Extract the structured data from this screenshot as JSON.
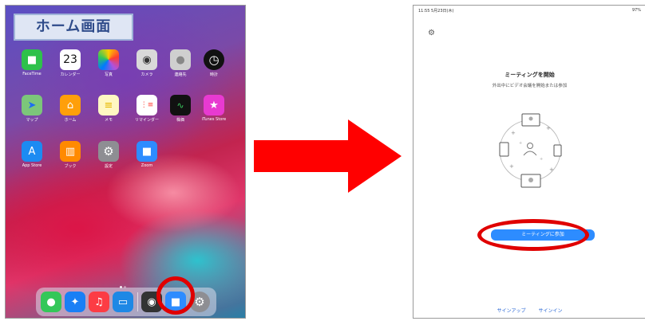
{
  "left_screen": {
    "label": "ホーム画面",
    "rows": [
      [
        {
          "name": "FaceTime",
          "icon": "facetime-icon",
          "color": "#2ec14b"
        },
        {
          "name": "カレンダー",
          "icon": "calendar-icon",
          "color": "#ffffff",
          "day": "23"
        },
        {
          "name": "写真",
          "icon": "photos-icon",
          "color": "#ffffff"
        },
        {
          "name": "カメラ",
          "icon": "camera-icon",
          "color": "#d9d9d9"
        },
        {
          "name": "連絡先",
          "icon": "contacts-icon",
          "color": "#cfcfcf"
        },
        {
          "name": "時計",
          "icon": "clock-icon",
          "color": "#111111"
        }
      ],
      [
        {
          "name": "マップ",
          "icon": "maps-icon",
          "color": "#7cc67a"
        },
        {
          "name": "ホーム",
          "icon": "home-icon",
          "color": "#ff9f0a"
        },
        {
          "name": "メモ",
          "icon": "notes-icon",
          "color": "#fff7c2"
        },
        {
          "name": "リマインダー",
          "icon": "reminders-icon",
          "color": "#ffffff"
        },
        {
          "name": "株価",
          "icon": "stocks-icon",
          "color": "#111111"
        },
        {
          "name": "iTunes Store",
          "icon": "itunes-store-icon",
          "color": "#e83ad1"
        }
      ],
      [
        {
          "name": "App Store",
          "icon": "app-store-icon",
          "color": "#1c8bf2"
        },
        {
          "name": "ブック",
          "icon": "books-icon",
          "color": "#ff8a00"
        },
        {
          "name": "設定",
          "icon": "settings-icon",
          "color": "#8e8e93"
        },
        {
          "name": "Zoom",
          "icon": "zoom-icon",
          "color": "#2d8cff"
        }
      ]
    ],
    "dock": [
      {
        "icon": "messages-icon",
        "color": "#34c759"
      },
      {
        "icon": "safari-icon",
        "color": "#1a7ff5"
      },
      {
        "icon": "music-icon",
        "color": "#fc3c44"
      },
      {
        "icon": "files-icon",
        "color": "#1e88e5"
      },
      {
        "icon": "camera-icon",
        "color": "#333333"
      },
      {
        "icon": "zoom-icon",
        "color": "#2d8cff"
      },
      {
        "icon": "settings-icon",
        "color": "#8e8e93"
      }
    ]
  },
  "right_screen": {
    "status_time": "11:55  5月23日(木)",
    "status_battery": "97%",
    "title": "ミーティングを開始",
    "subtitle": "外出中にビデオ会議を開始または参加",
    "join_button": "ミーティングに参加",
    "sign_up": "サインアップ",
    "sign_in": "サインイン"
  },
  "colors": {
    "highlight": "#e00000",
    "arrow": "#ff0000",
    "zoom_blue": "#2d8cff"
  }
}
